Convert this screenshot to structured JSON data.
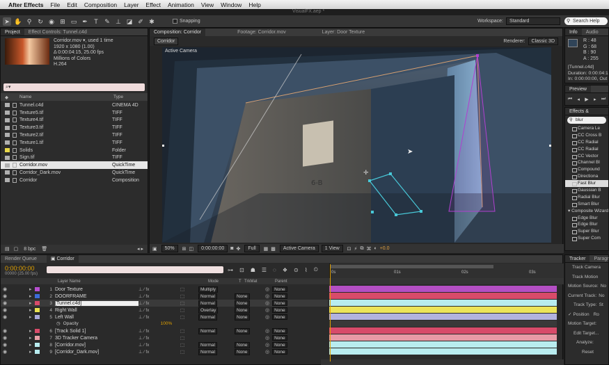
{
  "menubar": {
    "app_name": "After Effects",
    "items": [
      "File",
      "Edit",
      "Composition",
      "Layer",
      "Effect",
      "Animation",
      "View",
      "Window",
      "Help"
    ],
    "file_title": "VisualFX.aep *"
  },
  "toolbar": {
    "snapping_label": "Snapping",
    "workspace_label": "Workspace:",
    "workspace_value": "Standard",
    "search_placeholder": "Search Help"
  },
  "project": {
    "tabs": [
      "Project",
      "Effect Controls: Tunnel.c4d"
    ],
    "footage_info": [
      "Corridor.mov ▾, used 1 time",
      "1920 x 1080 (1.00)",
      "Δ 0:00:04:15, 25.00 fps",
      "Millions of Colors",
      "H.264"
    ],
    "search_value": "⌕▾",
    "col_name": "Name",
    "col_type": "Type",
    "items": [
      {
        "name": "Tunnel.c4d",
        "type": "CINEMA 4D",
        "label_color": "#b0b0b0"
      },
      {
        "name": "Texture5.tif",
        "type": "TIFF",
        "label_color": "#b0b0b0"
      },
      {
        "name": "Texture4.tif",
        "type": "TIFF",
        "label_color": "#b0b0b0"
      },
      {
        "name": "Texture3.tif",
        "type": "TIFF",
        "label_color": "#b0b0b0"
      },
      {
        "name": "Texture2.tif",
        "type": "TIFF",
        "label_color": "#b0b0b0"
      },
      {
        "name": "Texture1.tif",
        "type": "TIFF",
        "label_color": "#b0b0b0"
      },
      {
        "name": "Solids",
        "type": "Folder",
        "label_color": "#e8d84a"
      },
      {
        "name": "Sign.tif",
        "type": "TIFF",
        "label_color": "#b0b0b0"
      },
      {
        "name": "Corridor.mov",
        "type": "QuickTime",
        "label_color": "#b0b0b0"
      },
      {
        "name": "Corridor_Dark.mov",
        "type": "QuickTime",
        "label_color": "#b0b0b0"
      },
      {
        "name": "Corridor",
        "type": "Composition",
        "label_color": "#b0b0b0"
      }
    ],
    "bpc_label": "8 bpc"
  },
  "composition": {
    "tabs": [
      "Composition: Corridor",
      "Footage: Corridor.mov",
      "Layer: Door Texture"
    ],
    "sub_tab": "Corridor",
    "renderer_label": "Renderer:",
    "renderer_value": "Classic 3D",
    "camera_label": "Active Camera",
    "sign_text": "6-B",
    "zoom": "50%",
    "timecode": "0:00:00:00",
    "resolution": "Full",
    "view_camera": "Active Camera",
    "view_count": "1 View",
    "exposure": "+0.0"
  },
  "info": {
    "tabs": [
      "Info",
      "Audio"
    ],
    "r": "R : 48",
    "g": "G : 68",
    "b": "B : 90",
    "a": "A : 255",
    "layer_name": "[Tunnel.c4d]",
    "duration": "Duration: 0:00:04:1",
    "in_out": "In: 0:00:00:00, Out"
  },
  "preview": {
    "tab": "Preview"
  },
  "effects": {
    "tab": "Effects & Presets",
    "search_value": "blur",
    "categories": [
      "Blur & Sharpen",
      "Composite Wizard"
    ],
    "blur_items": [
      "Camera Le",
      "CC Cross B",
      "CC Radial",
      "CC Radial",
      "CC Vector",
      "Channel Bl",
      "Compound",
      "Directiona",
      "Fast Blur",
      "Gaussian B",
      "Radial Blur",
      "Smart Blur"
    ],
    "composite_items": [
      "Edge Blur",
      "Edge Blur",
      "Super Blur",
      "Super Com"
    ],
    "selected": "Fast Blur"
  },
  "tracker": {
    "tabs": [
      "Tracker",
      "Paragr"
    ],
    "track_camera": "Track Camera",
    "track_motion": "Track Motion",
    "motion_source": "Motion Source:",
    "motion_source_value": "No",
    "current_track": "Current Track:",
    "current_track_value": "No",
    "track_type": "Track Type:",
    "track_type_value": "St",
    "position": "Position",
    "rotation": "Ro",
    "motion_target": "Motion Target:",
    "edit_target": "Edit Target...",
    "analyze": "Analyze:",
    "reset": "Reset"
  },
  "timeline": {
    "tabs": [
      "Render Queue",
      "Corridor"
    ],
    "timecode": "0:00:00:00",
    "frame_info": "00000 (25.00 fps)",
    "col_layer_name": "Layer Name",
    "col_mode": "Mode",
    "col_t": "T",
    "col_trkmat": "TrkMat",
    "col_parent": "Parent",
    "ruler_ticks": [
      "0s",
      "01s",
      "02s",
      "03s"
    ],
    "opacity_label": "Opacity",
    "opacity_value": "100%",
    "layers": [
      {
        "num": "1",
        "name": "Door Texture",
        "mode": "Multiply",
        "trkmat": "",
        "parent": "None",
        "color": "#b84fd0",
        "bar": "#b44fc4"
      },
      {
        "num": "2",
        "name": "DOORFRAME",
        "mode": "Normal",
        "trkmat": "None",
        "parent": "None",
        "color": "#3c6cd8",
        "bar": "#d84b6a"
      },
      {
        "num": "3",
        "name": "[Tunnel.c4d]",
        "mode": "Normal",
        "trkmat": "None",
        "parent": "None",
        "color": "#d84b6a",
        "bar": "#b8ecef"
      },
      {
        "num": "4",
        "name": "Right Wall",
        "mode": "Overlay",
        "trkmat": "None",
        "parent": "None",
        "color": "#e8e050",
        "bar": "#ece45a"
      },
      {
        "num": "5",
        "name": "Left Wall",
        "mode": "Normal",
        "trkmat": "None",
        "parent": "None",
        "color": "#a8a8d8",
        "bar": "#b2b2de"
      },
      {
        "num": "6",
        "name": "[Track Solid 1]",
        "mode": "Normal",
        "trkmat": "None",
        "parent": "None",
        "color": "#d84b6a",
        "bar": "#d84b6a"
      },
      {
        "num": "7",
        "name": "3D Tracker Camera",
        "mode": "",
        "trkmat": "",
        "parent": "None",
        "color": "#e8a0a8",
        "bar": "#e89aa6"
      },
      {
        "num": "8",
        "name": "[Corridor.mov]",
        "mode": "Normal",
        "trkmat": "None",
        "parent": "None",
        "color": "#b8ecef",
        "bar": "#b8ecef"
      },
      {
        "num": "9",
        "name": "[Corridor_Dark.mov]",
        "mode": "Normal",
        "trkmat": "None",
        "parent": "None",
        "color": "#b8ecef",
        "bar": "#b8ecef"
      }
    ]
  }
}
